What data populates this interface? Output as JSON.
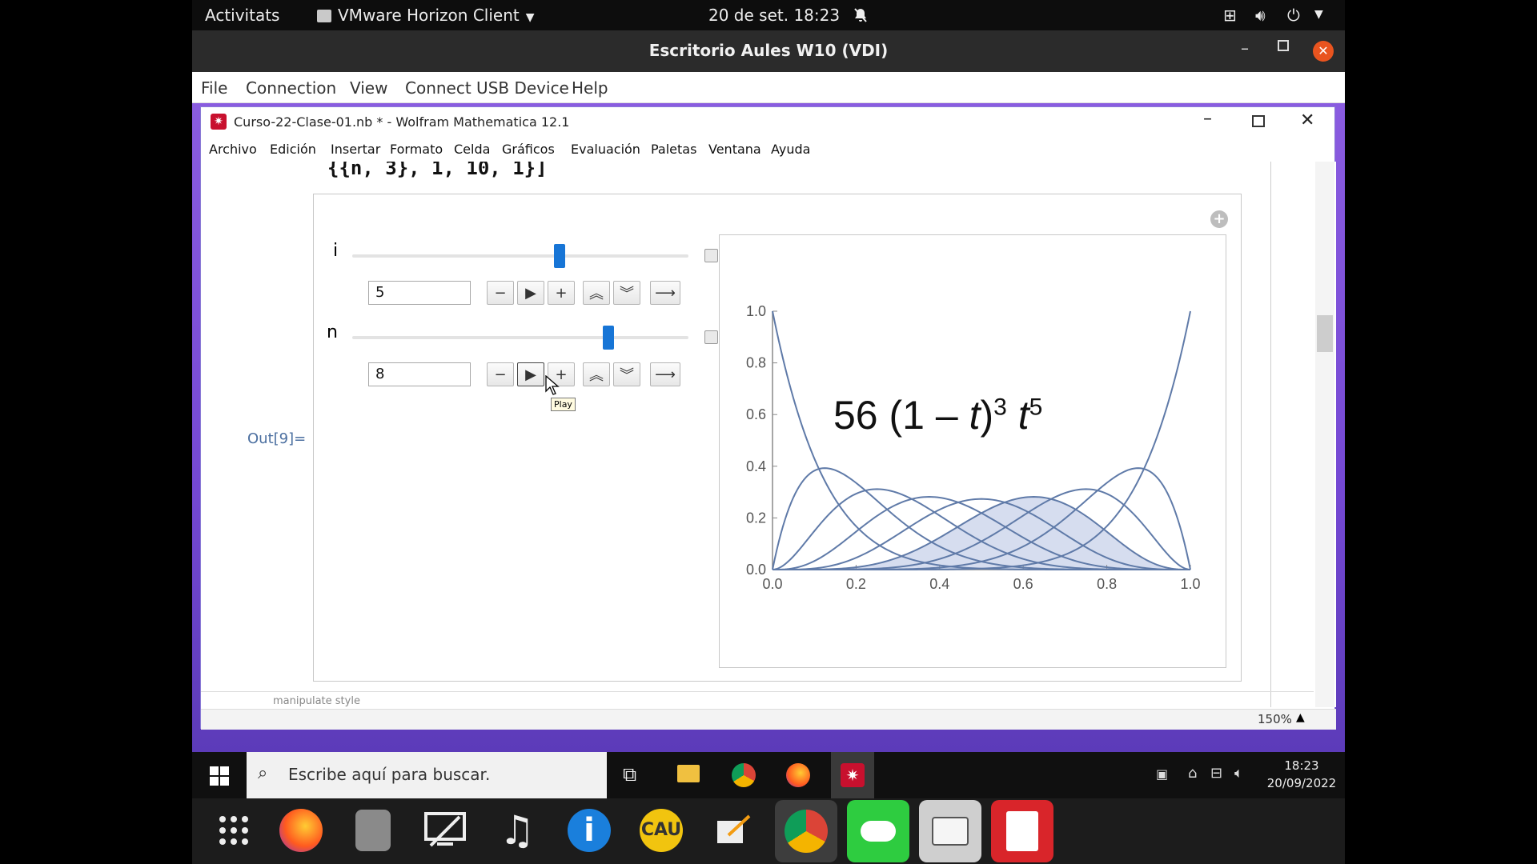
{
  "gnome_bar": {
    "activities": "Activitats",
    "app_name": "VMware Horizon Client",
    "clock": "20 de set.  18:23"
  },
  "vmware": {
    "title": "Escritorio Aules W10 (VDI)",
    "menu": [
      "File",
      "Connection",
      "View",
      "Connect USB Device",
      "Help"
    ]
  },
  "mathematica": {
    "title": "Curso-22-Clase-01.nb * - Wolfram Mathematica 12.1",
    "menu": [
      "Archivo",
      "Edición",
      "Insertar",
      "Formato",
      "Celda",
      "Gráficos",
      "Evaluación",
      "Paletas",
      "Ventana",
      "Ayuda"
    ],
    "input_code": "{{n, 3}, 1, 10, 1}]",
    "out_label": "Out[9]=",
    "zoom": "150%",
    "bottom_toolbar_label": "manipulate style"
  },
  "manipulate": {
    "controls": [
      {
        "name": "i",
        "value": "5",
        "slider_fraction": 0.62
      },
      {
        "name": "n",
        "value": "8",
        "slider_fraction": 0.77
      }
    ],
    "tooltip": "Play",
    "plot": {
      "formula_coef": "56",
      "formula_base": "(1 – ",
      "formula_var": "t",
      "formula_close": ")",
      "formula_exp1": "3",
      "formula_t": "t",
      "formula_exp2": "5"
    }
  },
  "chart_data": {
    "type": "line",
    "title": "56 (1 – t)^3 t^5",
    "xlabel": "",
    "ylabel": "",
    "xlim": [
      0.0,
      1.0
    ],
    "ylim": [
      0.0,
      1.0
    ],
    "x_ticks": [
      "0.0",
      "0.2",
      "0.4",
      "0.6",
      "0.8",
      "1.0"
    ],
    "y_ticks": [
      "0.0",
      "0.2",
      "0.4",
      "0.6",
      "0.8",
      "1.0"
    ],
    "bernstein_degree": 8,
    "highlighted_index": 5,
    "series_k": [
      0,
      1,
      2,
      3,
      4,
      5,
      6,
      7,
      8
    ],
    "grid": false
  },
  "windows_taskbar": {
    "search_placeholder": "Escribe aquí para buscar.",
    "time": "18:23",
    "date": "20/09/2022"
  },
  "colors": {
    "curve": "#5f7aa8",
    "fill": "#d6ddef",
    "slider": "#1775d6",
    "out_label": "#4b6fa0"
  }
}
